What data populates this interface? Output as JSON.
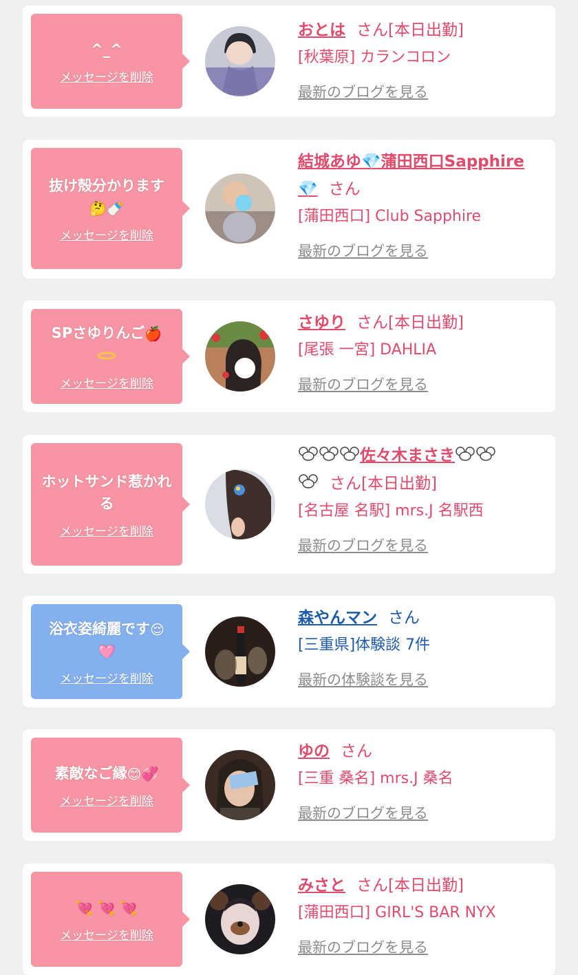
{
  "items": [
    {
      "message": "^_^",
      "delete_label": "メッセージを削除",
      "name": "おとは",
      "san": "さん[本日出勤]",
      "shop": "[秋葉原] カランコロン",
      "link": "最新のブログを見る"
    },
    {
      "message": "抜け殻分かります",
      "delete_label": "メッセージを削除",
      "name": "結城あゆ💎蒲田西口Sapphire",
      "name_line2": "💎",
      "san": "さん",
      "shop": "[蒲田西口] Club Sapphire",
      "link": "最新のブログを見る"
    },
    {
      "message": "SPさゆりんご",
      "delete_label": "メッセージを削除",
      "name": "さゆり",
      "san": "さん[本日出勤]",
      "shop": "[尾張 一宮] DAHLIA",
      "link": "最新のブログを見る"
    },
    {
      "message": "ホットサンド惹かれる",
      "delete_label": "メッセージを削除",
      "name": "佐々木まさき",
      "san": "さん[本日出勤]",
      "shop": "[名古屋 名駅] mrs.J 名駅西",
      "link": "最新のブログを見る"
    },
    {
      "message": "浴衣姿綺麗です",
      "delete_label": "メッセージを削除",
      "name": "森やんマン",
      "san": "さん",
      "shop": "[三重県]体験談 7件",
      "link": "最新の体験談を見る"
    },
    {
      "message": "素敵なご縁",
      "delete_label": "メッセージを削除",
      "name": "ゆの",
      "san": "さん",
      "shop": "[三重 桑名] mrs.J 桑名",
      "link": "最新のブログを見る"
    },
    {
      "message": "",
      "delete_label": "メッセージを削除",
      "name": "みさと",
      "san": "さん[本日出勤]",
      "shop": "[蒲田西口] GIRL'S BAR NYX",
      "link": "最新のブログを見る"
    }
  ],
  "colors": {
    "pink_bubble": "#f795a4",
    "blue_bubble": "#84b0ee",
    "pink_text": "#e04a6b",
    "blue_text": "#1d5aa8",
    "gray_link": "#8c8c8c",
    "page_bg": "#efefef"
  }
}
